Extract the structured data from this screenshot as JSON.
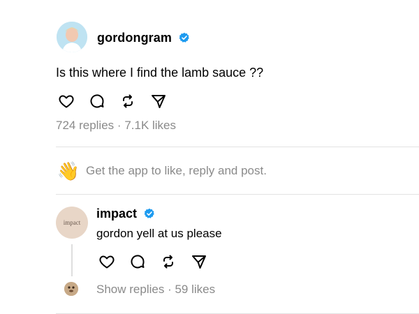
{
  "main_post": {
    "username": "gordongram",
    "verified": true,
    "text": "Is this where I find the lamb sauce ??",
    "replies": "724 replies",
    "separator": "·",
    "likes": "7.1K likes"
  },
  "get_app": {
    "emoji": "👋",
    "text": "Get the app to like, reply and post."
  },
  "reply_post": {
    "avatar_text": "impact",
    "username": "impact",
    "verified": true,
    "text": "gordon yell at us please",
    "show_replies": "Show replies",
    "separator": "·",
    "likes": "59 likes"
  },
  "icons": {
    "like": "heart-icon",
    "reply": "comment-icon",
    "repost": "repost-icon",
    "share": "send-icon",
    "verified": "verified-badge-icon"
  },
  "colors": {
    "verified": "#1d9bf0",
    "muted_text": "#8a8a8a",
    "divider": "#e3e3e3"
  }
}
